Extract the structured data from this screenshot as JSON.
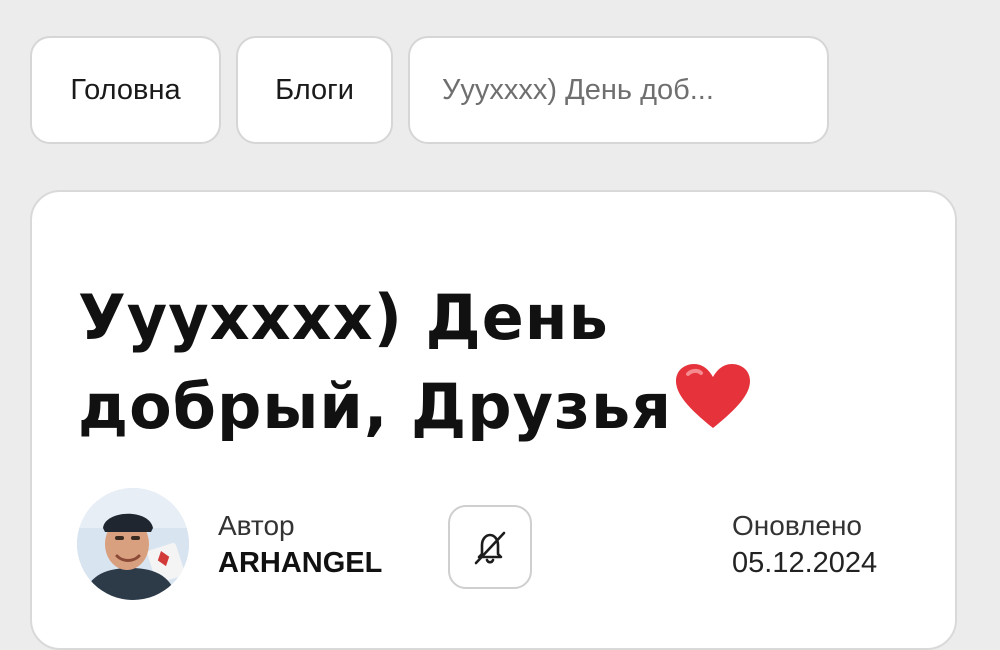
{
  "breadcrumbs": {
    "home": "Головна",
    "blogs": "Блоги",
    "current": "Ууухххх) День доб..."
  },
  "post": {
    "title": "Ууухххх) День добрый, Друзья",
    "title_emoji": "heart-emoji",
    "author_label": "Автор",
    "author_name": "ARHANGEL",
    "updated_label": "Оновлено",
    "updated_date": "05.12.2024",
    "subscribe_icon": "bell-off-icon"
  },
  "colors": {
    "page_background": "#ececec",
    "card_background": "#ffffff",
    "heart": "#e5323b"
  }
}
